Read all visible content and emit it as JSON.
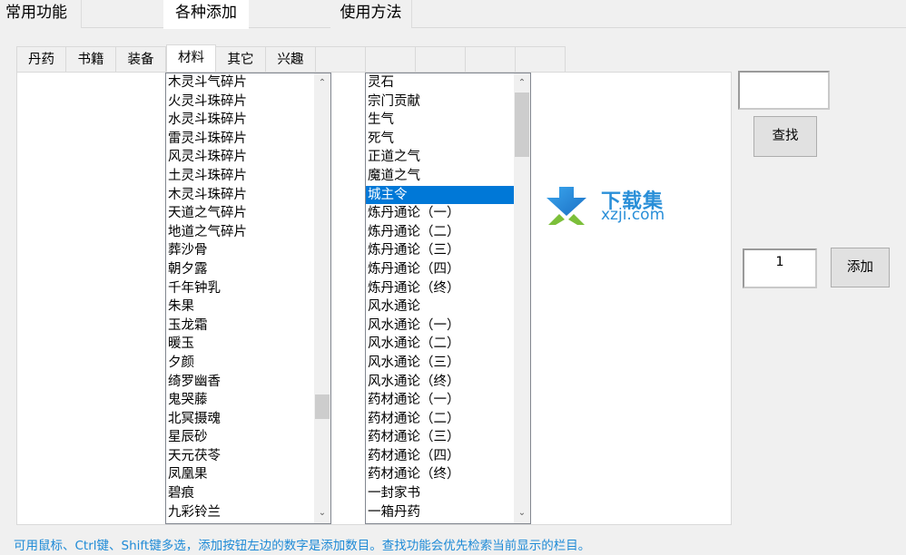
{
  "top_tabs": [
    {
      "label": "常用功能",
      "active": false
    },
    {
      "label": "各种添加",
      "active": true
    },
    {
      "label": "使用方法",
      "active": false
    }
  ],
  "sub_tabs": [
    {
      "label": "丹药",
      "active": false
    },
    {
      "label": "书籍",
      "active": false
    },
    {
      "label": "装备",
      "active": false
    },
    {
      "label": "材料",
      "active": true
    },
    {
      "label": "其它",
      "active": false
    },
    {
      "label": "兴趣",
      "active": false
    },
    {
      "label": "",
      "active": false
    },
    {
      "label": "",
      "active": false
    },
    {
      "label": "",
      "active": false
    },
    {
      "label": "",
      "active": false
    },
    {
      "label": "",
      "active": false
    },
    {
      "label": "",
      "active": false
    },
    {
      "label": "",
      "active": false
    }
  ],
  "list_materials": {
    "items": [
      "木灵斗气碎片",
      "火灵斗珠碎片",
      "水灵斗珠碎片",
      "雷灵斗珠碎片",
      "风灵斗珠碎片",
      "土灵斗珠碎片",
      "木灵斗珠碎片",
      "天道之气碎片",
      "地道之气碎片",
      "葬沙骨",
      "朝夕露",
      "千年钟乳",
      "朱果",
      "玉龙霜",
      "暖玉",
      "夕颜",
      "绮罗幽香",
      "鬼哭藤",
      "北冥摄魂",
      "星辰砂",
      "天元茯苓",
      "凤凰果",
      "碧痕",
      "九彩铃兰"
    ],
    "scroll_position": 0.72
  },
  "list_others": {
    "items": [
      "灵石",
      "宗门贡献",
      "生气",
      "死气",
      "正道之气",
      "魔道之气",
      "城主令",
      "炼丹通论（一）",
      "炼丹通论（二）",
      "炼丹通论（三）",
      "炼丹通论（四）",
      "炼丹通论（终）",
      "风水通论",
      "风水通论（一）",
      "风水通论（二）",
      "风水通论（三）",
      "风水通论（终）",
      "药材通论（一）",
      "药材通论（二）",
      "药材通论（三）",
      "药材通论（四）",
      "药材通论（终）",
      "一封家书",
      "一箱丹药"
    ],
    "selected_index": 6,
    "scroll_position": 0.0
  },
  "scroll_up_glyph": "⌃",
  "scroll_down_glyph": "⌄",
  "logo": {
    "cn": "下载集",
    "en": "xzji.com",
    "brand_color": "#2a8fd8",
    "accent_color": "#7cbf3a"
  },
  "search": {
    "value": "",
    "button_label": "查找"
  },
  "quantity": {
    "value": "1",
    "button_label": "添加"
  },
  "hint": "可用鼠标、Ctrl键、Shift键多选，添加按钮左边的数字是添加数目。查找功能会优先检索当前显示的栏目。",
  "colors": {
    "selection": "#0078d7",
    "hint_text": "#1e8ad6"
  }
}
